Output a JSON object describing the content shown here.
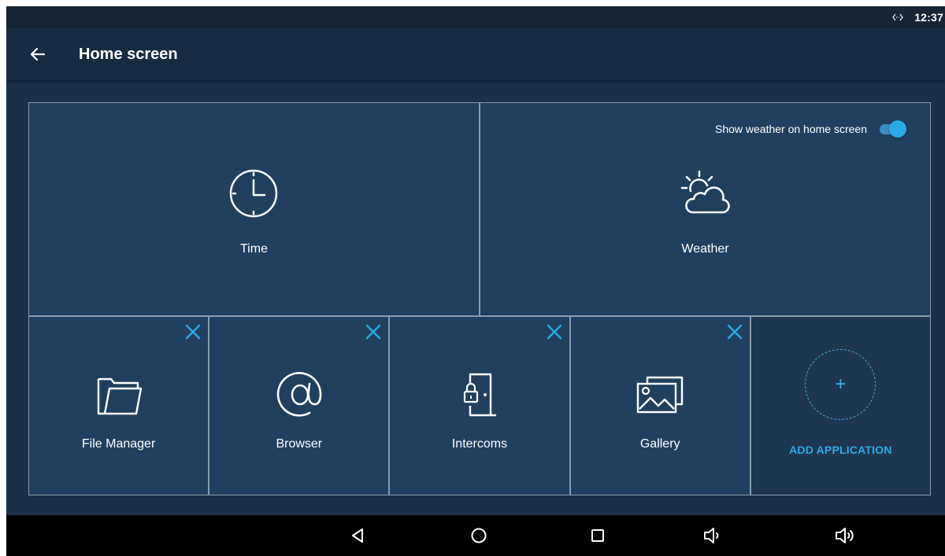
{
  "status_bar": {
    "time": "12:37",
    "connection_icon": "link-arrows-icon"
  },
  "app_bar": {
    "title": "Home screen",
    "back_icon": "arrow-left-icon"
  },
  "tiles": {
    "time": {
      "label": "Time",
      "icon": "clock-icon"
    },
    "weather": {
      "label": "Weather",
      "icon": "weather-icon",
      "toggle_label": "Show weather on home screen",
      "toggle_on": true
    },
    "apps": [
      {
        "label": "File Manager",
        "icon": "folder-icon"
      },
      {
        "label": "Browser",
        "icon": "at-sign-icon"
      },
      {
        "label": "Intercoms",
        "icon": "intercom-door-icon"
      },
      {
        "label": "Gallery",
        "icon": "gallery-icon"
      }
    ],
    "add": {
      "label": "ADD APPLICATION",
      "symbol": "+"
    }
  },
  "nav_bar": [
    "back-triangle-icon",
    "home-circle-icon",
    "recents-square-icon",
    "volume-down-icon",
    "volume-up-icon"
  ],
  "colors": {
    "accent": "#2ba9e6",
    "tile": "#21405f",
    "background": "#1a3148",
    "app_bar": "#182c41"
  }
}
